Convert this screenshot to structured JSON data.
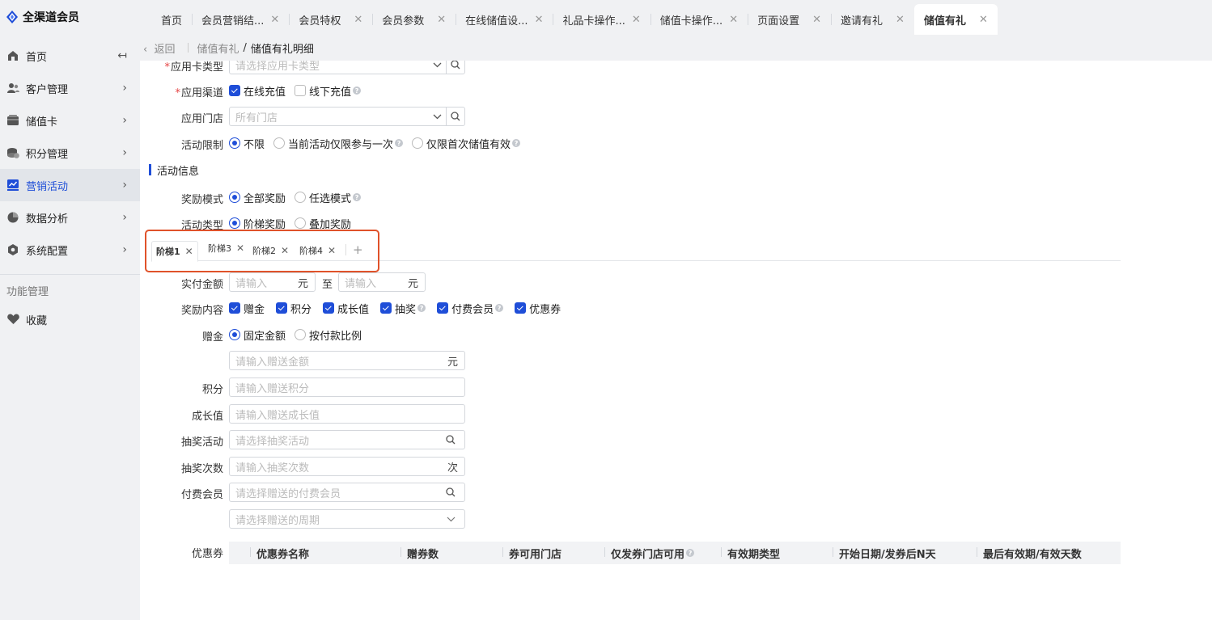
{
  "app": {
    "title": "全渠道会员"
  },
  "sidebar": {
    "collapse_icon": "↤",
    "items": [
      {
        "label": "首页",
        "icon": "home-icon",
        "has_arrow": false
      },
      {
        "label": "客户管理",
        "icon": "users-icon",
        "has_arrow": true
      },
      {
        "label": "储值卡",
        "icon": "card-icon",
        "has_arrow": true
      },
      {
        "label": "积分管理",
        "icon": "coins-icon",
        "has_arrow": true
      },
      {
        "label": "营销活动",
        "icon": "chart-icon",
        "has_arrow": true,
        "active": true
      },
      {
        "label": "数据分析",
        "icon": "pie-icon",
        "has_arrow": true
      },
      {
        "label": "系统配置",
        "icon": "settings-icon",
        "has_arrow": true
      }
    ],
    "section_label": "功能管理",
    "favorites_label": "收藏"
  },
  "tabs": [
    {
      "label": "首页",
      "closable": false
    },
    {
      "label": "会员营销结...",
      "closable": true
    },
    {
      "label": "会员特权",
      "closable": true
    },
    {
      "label": "会员参数",
      "closable": true
    },
    {
      "label": "在线储值设...",
      "closable": true
    },
    {
      "label": "礼品卡操作...",
      "closable": true
    },
    {
      "label": "储值卡操作...",
      "closable": true
    },
    {
      "label": "页面设置",
      "closable": true
    },
    {
      "label": "邀请有礼",
      "closable": true
    },
    {
      "label": "储值有礼",
      "closable": true,
      "active": true
    }
  ],
  "breadcrumb": {
    "back": "返回",
    "parent": "储值有礼",
    "separator": "/",
    "current": "储值有礼明细"
  },
  "form": {
    "card_type": {
      "label": "应用卡类型",
      "placeholder": "请选择应用卡类型"
    },
    "channel": {
      "label": "应用渠道",
      "options": [
        {
          "label": "在线充值",
          "checked": true
        },
        {
          "label": "线下充值",
          "checked": false
        }
      ]
    },
    "store": {
      "label": "应用门店",
      "placeholder": "所有门店"
    },
    "limit": {
      "label": "活动限制",
      "options": [
        {
          "label": "不限",
          "selected": true
        },
        {
          "label": "当前活动仅限参与一次",
          "selected": false
        },
        {
          "label": "仅限首次储值有效",
          "selected": false
        }
      ]
    },
    "section_title": "活动信息",
    "reward_mode": {
      "label": "奖励模式",
      "options": [
        {
          "label": "全部奖励",
          "selected": true
        },
        {
          "label": "任选模式",
          "selected": false
        }
      ]
    },
    "activity_type": {
      "label": "活动类型",
      "options": [
        {
          "label": "阶梯奖励",
          "selected": true
        },
        {
          "label": "叠加奖励",
          "selected": false
        }
      ]
    },
    "steps": [
      "阶梯1",
      "阶梯3",
      "阶梯2",
      "阶梯4"
    ],
    "step_add": "+",
    "paid_amount": {
      "label": "实付金额",
      "from_placeholder": "请输入",
      "to_placeholder": "请输入",
      "unit": "元",
      "to_text": "至"
    },
    "reward_content": {
      "label": "奖励内容",
      "options": [
        {
          "label": "赠金",
          "checked": true
        },
        {
          "label": "积分",
          "checked": true
        },
        {
          "label": "成长值",
          "checked": true
        },
        {
          "label": "抽奖",
          "checked": true
        },
        {
          "label": "付费会员",
          "checked": true
        },
        {
          "label": "优惠券",
          "checked": true
        }
      ]
    },
    "bonus": {
      "label": "赠金",
      "options": [
        {
          "label": "固定金额",
          "selected": true
        },
        {
          "label": "按付款比例",
          "selected": false
        }
      ],
      "placeholder": "请输入赠送金额",
      "unit": "元"
    },
    "points": {
      "label": "积分",
      "placeholder": "请输入赠送积分"
    },
    "growth": {
      "label": "成长值",
      "placeholder": "请输入赠送成长值"
    },
    "lottery": {
      "label": "抽奖活动",
      "placeholder": "请选择抽奖活动"
    },
    "lottery_times": {
      "label": "抽奖次数",
      "placeholder": "请输入抽奖次数",
      "unit": "次"
    },
    "paid_member": {
      "label": "付费会员",
      "placeholder": "请选择赠送的付费会员",
      "period_placeholder": "请选择赠送的周期"
    },
    "coupon": {
      "label": "优惠券",
      "columns": [
        "优惠券名称",
        "赠券数",
        "券可用门店",
        "仅发券门店可用",
        "有效期类型",
        "开始日期/发券后N天",
        "最后有效期/有效天数"
      ]
    }
  },
  "colors": {
    "accent": "#1f4ed8",
    "highlight": "#e0522a",
    "required": "#e54545"
  }
}
